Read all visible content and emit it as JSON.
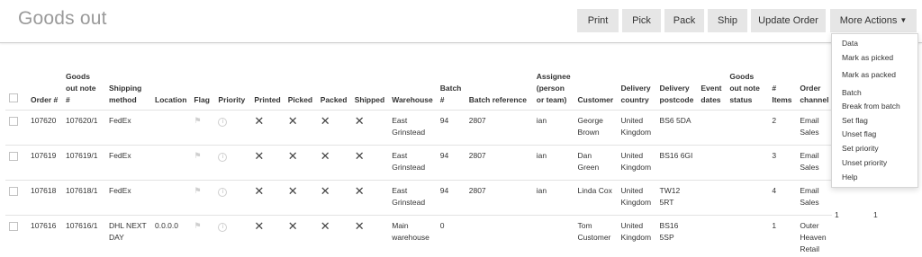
{
  "page": {
    "title": "Goods out"
  },
  "toolbar": {
    "print": "Print",
    "pick": "Pick",
    "pack": "Pack",
    "ship": "Ship",
    "update_order": "Update Order",
    "more_actions": "More Actions"
  },
  "more_actions_menu": [
    "Data",
    "Mark as picked",
    "Mark as packed",
    "Batch",
    "Break from batch",
    "Set flag",
    "Unset flag",
    "Set priority",
    "Unset priority",
    "Help"
  ],
  "columns": {
    "order": "Order #",
    "goods_note": "Goods out note #",
    "shipping": "Shipping method",
    "location": "Location",
    "flag": "Flag",
    "priority": "Priority",
    "printed": "Printed",
    "picked": "Picked",
    "packed": "Packed",
    "shipped": "Shipped",
    "warehouse": "Warehouse",
    "batch": "Batch #",
    "batch_ref": "Batch reference",
    "assignee": "Assignee (person or team)",
    "customer": "Customer",
    "country": "Delivery country",
    "postcode": "Delivery postcode",
    "event_dates": "Event dates",
    "note_status": "Goods out note status",
    "items": "# Items",
    "channel": "Order channel"
  },
  "rows": [
    {
      "order": "107620",
      "note": "107620/1",
      "shipping": "FedEx",
      "location": "",
      "printed": "✕",
      "picked": "✕",
      "packed": "✕",
      "shipped": "✕",
      "warehouse": "East Grinstead",
      "batch": "94",
      "batch_ref": "2807",
      "assignee": "ian",
      "customer": "George Brown",
      "country": "United Kingdom",
      "postcode": "BS6 5DA",
      "event_dates": "",
      "status": "",
      "items": "2",
      "channel": "Email Sales"
    },
    {
      "order": "107619",
      "note": "107619/1",
      "shipping": "FedEx",
      "location": "",
      "printed": "✕",
      "picked": "✕",
      "packed": "✕",
      "shipped": "✕",
      "warehouse": "East Grinstead",
      "batch": "94",
      "batch_ref": "2807",
      "assignee": "ian",
      "customer": "Dan Green",
      "country": "United Kingdom",
      "postcode": "BS16 6GI",
      "event_dates": "",
      "status": "",
      "items": "3",
      "channel": "Email Sales"
    },
    {
      "order": "107618",
      "note": "107618/1",
      "shipping": "FedEx",
      "location": "",
      "printed": "✕",
      "picked": "✕",
      "packed": "✕",
      "shipped": "✕",
      "warehouse": "East Grinstead",
      "batch": "94",
      "batch_ref": "2807",
      "assignee": "ian",
      "customer": "Linda Cox",
      "country": "United Kingdom",
      "postcode": "TW12 5RT",
      "event_dates": "",
      "status": "",
      "items": "4",
      "channel": "Email Sales"
    },
    {
      "order": "107616",
      "note": "107616/1",
      "shipping": "DHL NEXT DAY",
      "location": "0.0.0.0",
      "printed": "✕",
      "picked": "✕",
      "packed": "✕",
      "shipped": "✕",
      "warehouse": "Main warehouse",
      "batch": "0",
      "batch_ref": "",
      "assignee": "",
      "customer": "Tom Customer",
      "country": "United Kingdom",
      "postcode": "BS16 5SP",
      "event_dates": "",
      "status": "",
      "items": "1",
      "channel": "Outer Heaven Retail"
    }
  ],
  "overflow_values": [
    "1",
    "1"
  ],
  "icons": {
    "flag": "flag-icon",
    "priority": "info-icon",
    "caret": "chevron-down-icon"
  }
}
